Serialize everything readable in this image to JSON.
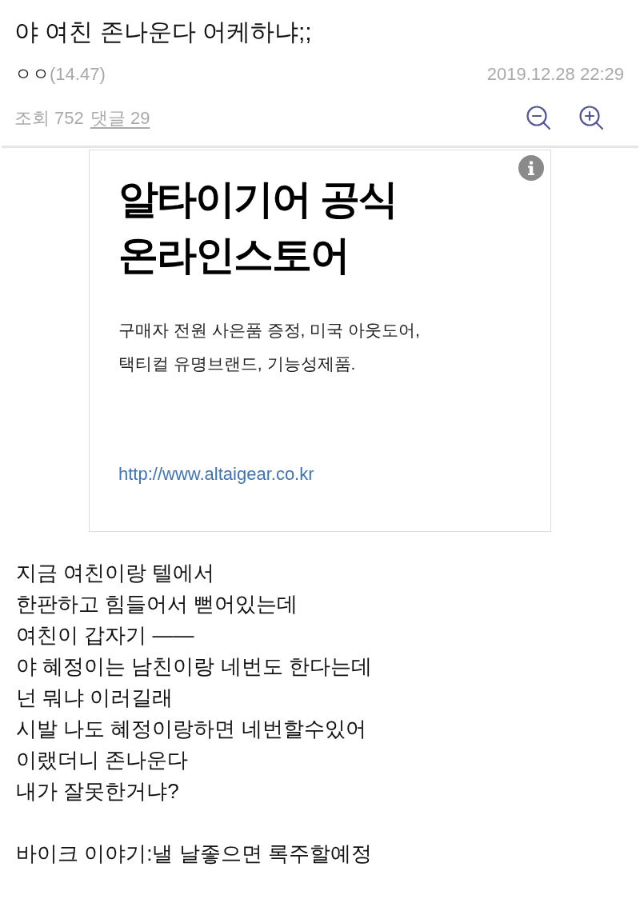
{
  "post": {
    "title": "야 여친 존나운다 어케하냐;;",
    "author": "ㅇㅇ",
    "author_ip": "(14.47)",
    "date": "2019.12.28 22:29",
    "views": "조회 752",
    "comments": "댓글 29"
  },
  "zoom_controls": [
    {
      "kind": "zoom_out"
    },
    {
      "kind": "zoom_in"
    }
  ],
  "ad": {
    "headline": [
      "알타이기어 공식",
      "온라인스토어"
    ],
    "description": [
      "구매자 전원 사은품 증정, 미국 아웃도어,",
      "택티컬 유명브랜드, 기능성제품."
    ],
    "url": "http://www.altaigear.co.kr"
  },
  "body": [
    [
      "지금 여친이랑 텔에서",
      "한판하고 힘들어서 뻗어있는데",
      "여친이 갑자기 ——",
      "야 혜정이는 남친이랑 네번도 한다는데",
      "넌 뭐냐 이러길래",
      "시발 나도 혜정이랑하면 네번할수있어",
      "이랬더니 존나운다",
      "내가 잘못한거냐?"
    ],
    [
      "바이크 이야기:낼 날좋으면 록주할예정"
    ]
  ]
}
